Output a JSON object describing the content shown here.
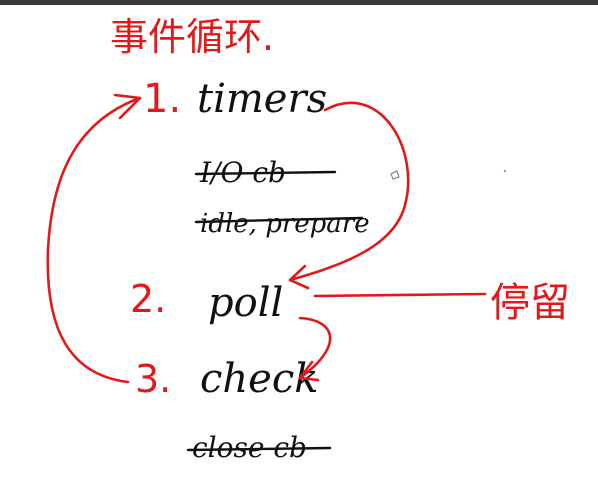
{
  "title": "事件循环.",
  "stay_label": "停留",
  "phases": [
    {
      "index": "1.",
      "name": "timers"
    },
    {
      "index": "",
      "name": "I/O cb",
      "struck": true
    },
    {
      "index": "",
      "name": "idle, prepare",
      "struck": true
    },
    {
      "index": "2.",
      "name": "poll"
    },
    {
      "index": "3.",
      "name": "check"
    },
    {
      "index": "",
      "name": "close cb",
      "struck": true
    }
  ],
  "colors": {
    "red_ink": "#e01a1a",
    "black_ink": "#111111",
    "top_bar": "#3a3a3a"
  }
}
